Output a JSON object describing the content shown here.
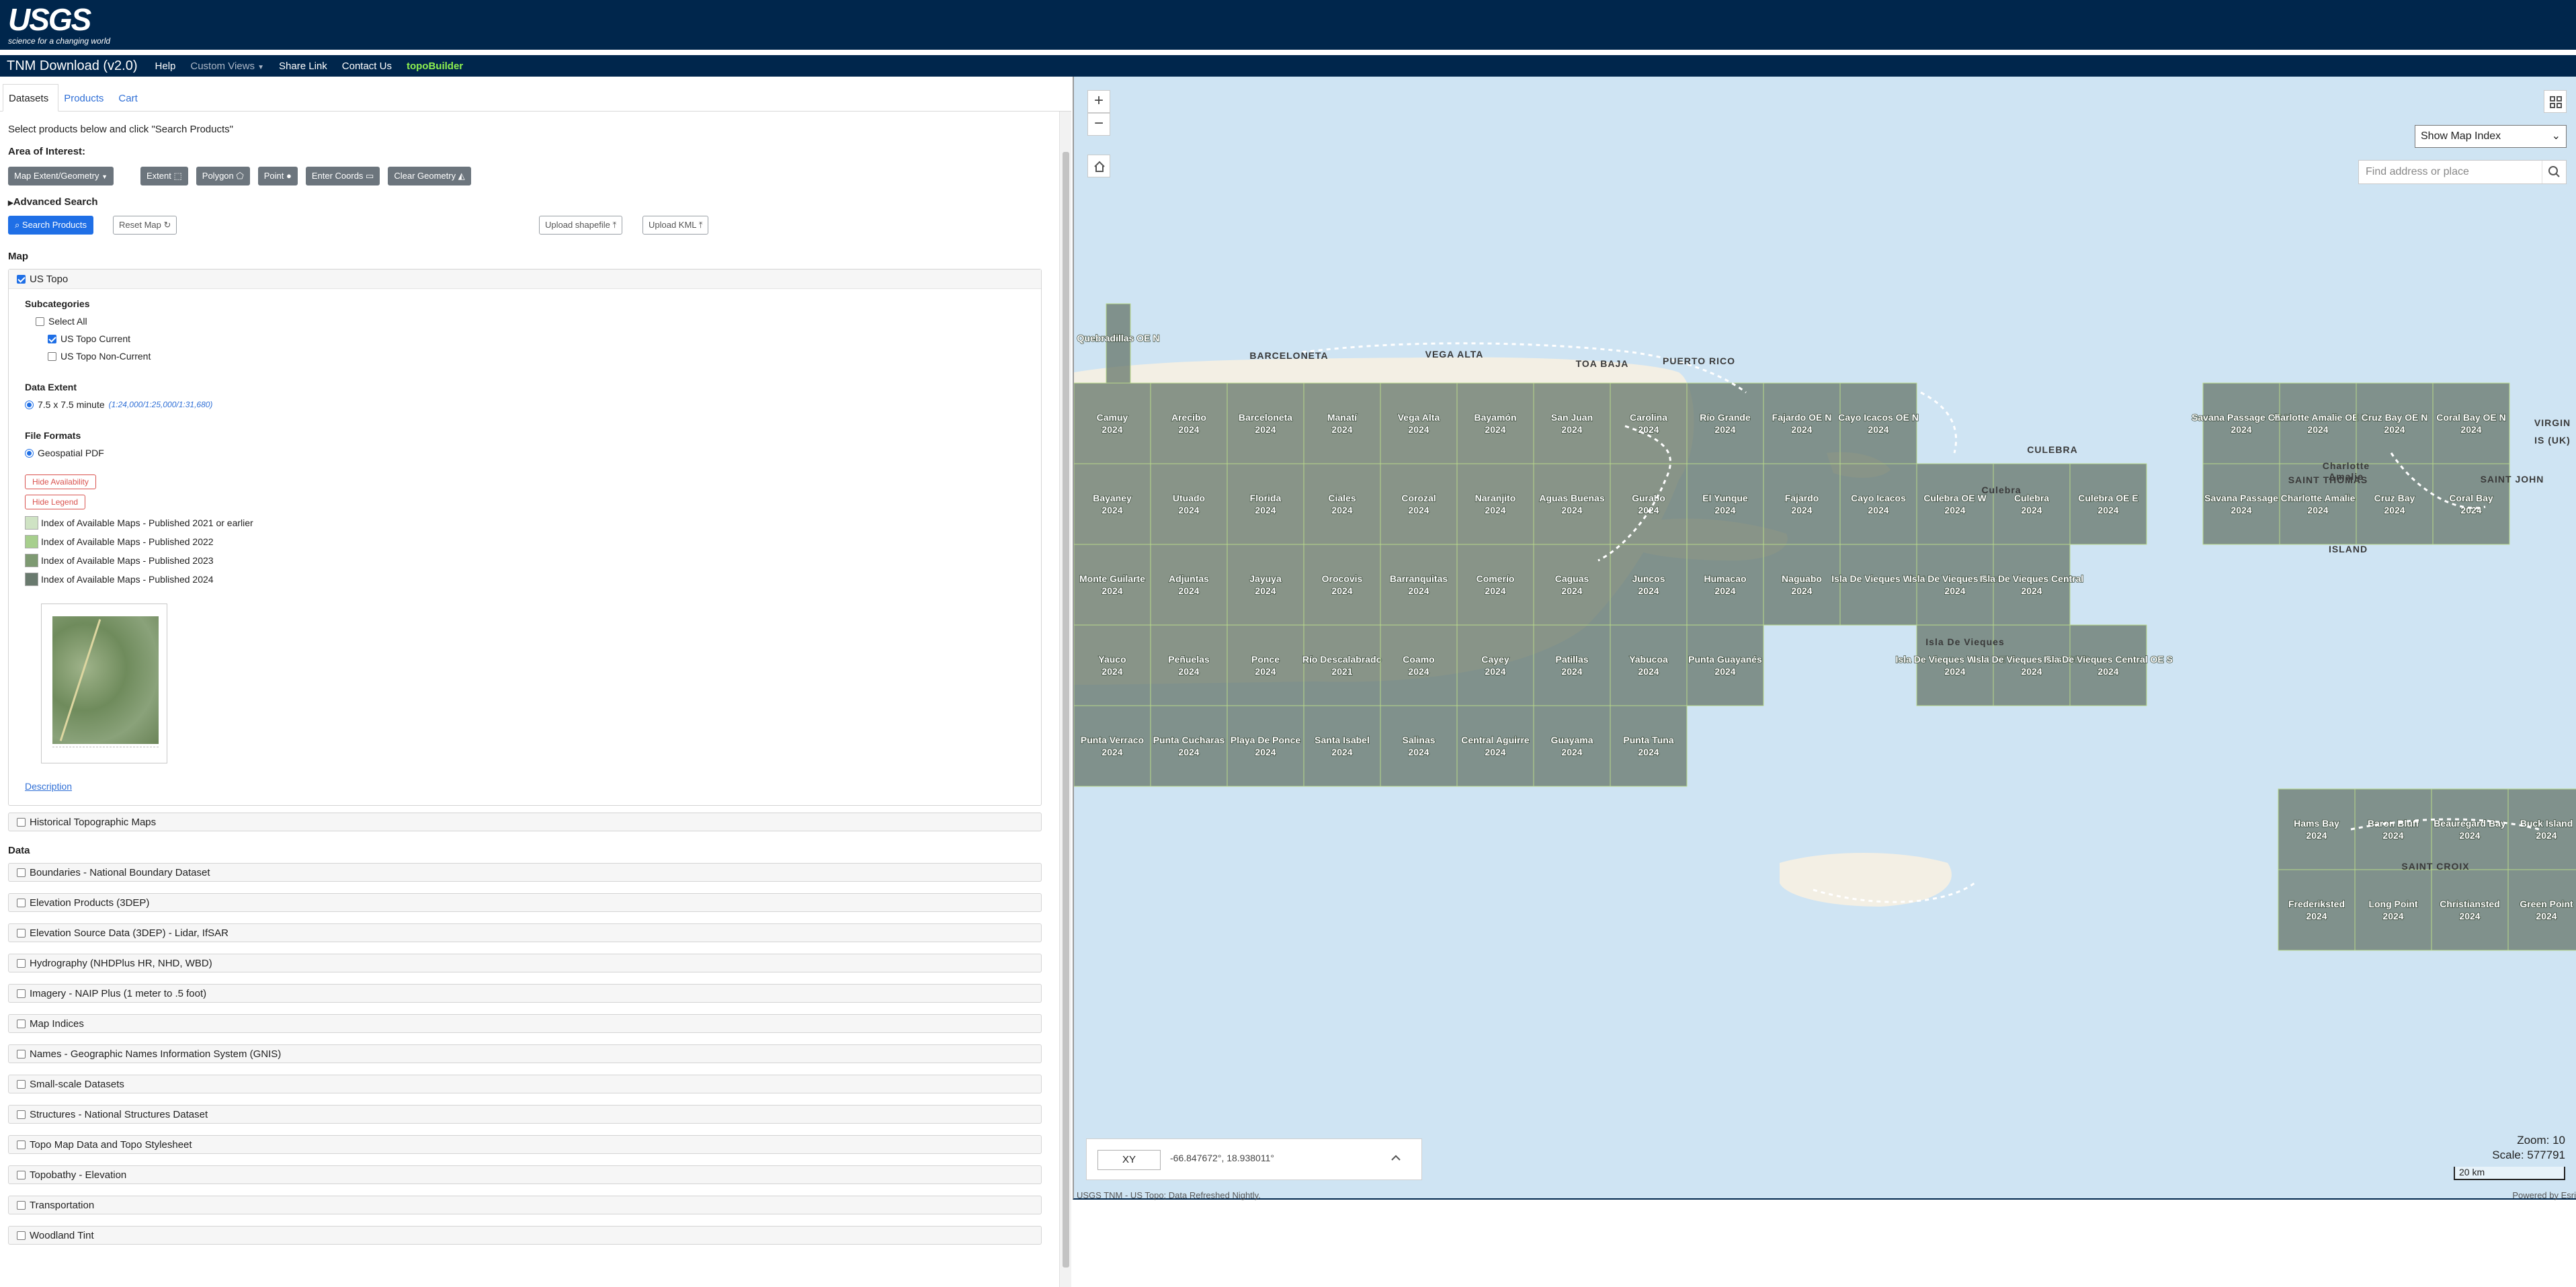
{
  "header": {
    "logo_text": "USGS",
    "logo_tagline": "science for a changing world",
    "app_title": "TNM Download (v2.0)",
    "nav": [
      "Help",
      "Custom Views",
      "Share Link",
      "Contact Us",
      "topoBuilder"
    ]
  },
  "tabs": [
    "Datasets",
    "Products",
    "Cart"
  ],
  "left": {
    "intro": "Select products below and click \"Search Products\"",
    "aoi_label": "Area of Interest:",
    "aoi_buttons": {
      "extent_menu": "Map Extent/Geometry",
      "extent": "Extent",
      "polygon": "Polygon",
      "point": "Point",
      "enter_coords": "Enter Coords",
      "clear_geometry": "Clear Geometry"
    },
    "advanced_search": "Advanced Search",
    "search_products": "Search Products",
    "reset_map": "Reset Map",
    "upload_shapefile": "Upload shapefile",
    "upload_kml": "Upload KML",
    "map_section": "Map",
    "us_topo": {
      "title": "US Topo",
      "checked": true,
      "subcategories_label": "Subcategories",
      "select_all": "Select All",
      "current": "US Topo Current",
      "non_current": "US Topo Non-Current",
      "data_extent_label": "Data Extent",
      "extent_value": "7.5 x 7.5 minute",
      "extent_scales": "(1:24,000/1:25,000/1:31,680)",
      "file_formats_label": "File Formats",
      "format": "Geospatial PDF",
      "hide_availability": "Hide Availability",
      "hide_legend": "Hide Legend",
      "legend": [
        {
          "label": "Index of Available Maps - Published 2021 or earlier",
          "color": "#cfe3c4"
        },
        {
          "label": "Index of Available Maps - Published 2022",
          "color": "#a7cf8d"
        },
        {
          "label": "Index of Available Maps - Published 2023",
          "color": "#7e9a72"
        },
        {
          "label": "Index of Available Maps - Published 2024",
          "color": "#697a6e"
        }
      ],
      "description_link": "Description"
    },
    "historical": "Historical Topographic Maps",
    "data_section": "Data",
    "datasets": [
      "Boundaries - National Boundary Dataset",
      "Elevation Products (3DEP)",
      "Elevation Source Data (3DEP) - Lidar, IfSAR",
      "Hydrography (NHDPlus HR, NHD, WBD)",
      "Imagery - NAIP Plus (1 meter to .5 foot)",
      "Map Indices",
      "Names - Geographic Names Information System (GNIS)",
      "Small-scale Datasets",
      "Structures - National Structures Dataset",
      "Topo Map Data and Topo Stylesheet",
      "Topobathy - Elevation",
      "Transportation",
      "Woodland Tint"
    ]
  },
  "map": {
    "zoom_in": "+",
    "zoom_out": "−",
    "layer_select": "Show Map Index",
    "search_placeholder": "Find address or place",
    "coord_mode": "XY",
    "coord_value": "-66.847672°, 18.938011°",
    "zoom_label": "Zoom: 10",
    "scale_label": "Scale: 577791",
    "scalebar": "20 km",
    "attribution": "USGS TNM - US Topo; Data Refreshed Nightly.",
    "powered_by": "Powered by Esri",
    "water_color": "#cfe4f3",
    "tile_color": "#697a6e",
    "place_labels": [
      "BARCELONETA",
      "VEGA ALTA",
      "TOA BAJA",
      "PUERTO RICO",
      "CULEBRA",
      "SAINT THOMAS",
      "ISLAND",
      "SAINT JOHN",
      "VIRGIN",
      "IS (UK)",
      "SAINT CROIX",
      "Isla De Vieques",
      "Charlotte",
      "Amalie",
      "Culebra"
    ],
    "tiles": [
      {
        "name": "Quebradillas OE N",
        "year": ""
      },
      {
        "name": "Camuy",
        "year": "2024"
      },
      {
        "name": "Arecibo",
        "year": "2024"
      },
      {
        "name": "Barceloneta",
        "year": "2024"
      },
      {
        "name": "Manatí",
        "year": "2024"
      },
      {
        "name": "Vega Alta",
        "year": "2024"
      },
      {
        "name": "Bayamón",
        "year": "2024"
      },
      {
        "name": "San Juan",
        "year": "2024"
      },
      {
        "name": "Carolina",
        "year": "2024"
      },
      {
        "name": "Río Grande",
        "year": "2024"
      },
      {
        "name": "Fajardo OE N",
        "year": "2024"
      },
      {
        "name": "Cayo Icacos OE N",
        "year": "2024"
      },
      {
        "name": "Bayaney",
        "year": "2024"
      },
      {
        "name": "Utuado",
        "year": "2024"
      },
      {
        "name": "Florida",
        "year": "2024"
      },
      {
        "name": "Ciales",
        "year": "2024"
      },
      {
        "name": "Corozal",
        "year": "2024"
      },
      {
        "name": "Naranjito",
        "year": "2024"
      },
      {
        "name": "Aguas Buenas",
        "year": "2024"
      },
      {
        "name": "Gurabo",
        "year": "2024"
      },
      {
        "name": "El Yunque",
        "year": "2024"
      },
      {
        "name": "Fajardo",
        "year": "2024"
      },
      {
        "name": "Cayo Icacos",
        "year": "2024"
      },
      {
        "name": "Culebra OE W",
        "year": "2024"
      },
      {
        "name": "Culebra",
        "year": "2024"
      },
      {
        "name": "Culebra OE E",
        "year": "2024"
      },
      {
        "name": "Monte Guilarte",
        "year": "2024"
      },
      {
        "name": "Adjuntas",
        "year": "2024"
      },
      {
        "name": "Jayuya",
        "year": "2024"
      },
      {
        "name": "Orocovis",
        "year": "2024"
      },
      {
        "name": "Barranquitas",
        "year": "2024"
      },
      {
        "name": "Comerío",
        "year": "2024"
      },
      {
        "name": "Caguas",
        "year": "2024"
      },
      {
        "name": "Juncos",
        "year": "2024"
      },
      {
        "name": "Humacao",
        "year": "2024"
      },
      {
        "name": "Naguabo",
        "year": "2024"
      },
      {
        "name": "Isla De Vieques West",
        "year": ""
      },
      {
        "name": "Isla De Vieques East",
        "year": "2024"
      },
      {
        "name": "Isla De Vieques Central",
        "year": "2024"
      },
      {
        "name": "Yauco",
        "year": "2024"
      },
      {
        "name": "Peñuelas",
        "year": "2024"
      },
      {
        "name": "Ponce",
        "year": "2024"
      },
      {
        "name": "Río Descalabrado",
        "year": "2021"
      },
      {
        "name": "Coamo",
        "year": "2024"
      },
      {
        "name": "Cayey",
        "year": "2024"
      },
      {
        "name": "Patillas",
        "year": "2024"
      },
      {
        "name": "Yabucoa",
        "year": "2024"
      },
      {
        "name": "Punta Guayanés",
        "year": "2024"
      },
      {
        "name": "Isla De Vieques West OE S",
        "year": "2024"
      },
      {
        "name": "Isla De Vieques East OE S",
        "year": "2024"
      },
      {
        "name": "Isla De Vieques Central OE S",
        "year": "2024"
      },
      {
        "name": "Punta Verraco",
        "year": "2024"
      },
      {
        "name": "Punta Cucharas",
        "year": "2024"
      },
      {
        "name": "Playa De Ponce",
        "year": "2024"
      },
      {
        "name": "Santa Isabel",
        "year": "2024"
      },
      {
        "name": "Salinas",
        "year": "2024"
      },
      {
        "name": "Central Aguirre",
        "year": "2024"
      },
      {
        "name": "Guayama",
        "year": "2024"
      },
      {
        "name": "Punta Tuna",
        "year": "2024"
      },
      {
        "name": "Savana Passage OE N",
        "year": "2024"
      },
      {
        "name": "Charlotte Amalie OE N",
        "year": "2024"
      },
      {
        "name": "Cruz Bay OE N",
        "year": "2024"
      },
      {
        "name": "Coral Bay OE N",
        "year": "2024"
      },
      {
        "name": "Savana Passage",
        "year": "2024"
      },
      {
        "name": "Charlotte Amalie",
        "year": "2024"
      },
      {
        "name": "Cruz Bay",
        "year": "2024"
      },
      {
        "name": "Coral Bay",
        "year": "2024"
      },
      {
        "name": "Hams Bay",
        "year": "2024"
      },
      {
        "name": "Baron Bluff",
        "year": "2024"
      },
      {
        "name": "Beauregard Bay",
        "year": "2024"
      },
      {
        "name": "Buck Island",
        "year": "2024"
      },
      {
        "name": "Frederiksted",
        "year": "2024"
      },
      {
        "name": "Long Point",
        "year": "2024"
      },
      {
        "name": "Christiansted",
        "year": "2024"
      },
      {
        "name": "Green Point",
        "year": "2024"
      }
    ]
  }
}
